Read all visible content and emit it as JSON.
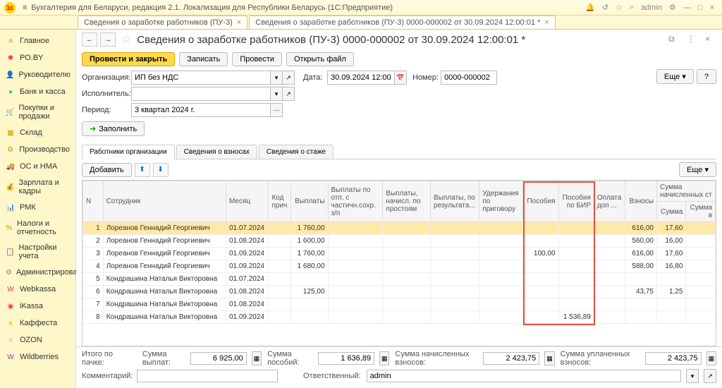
{
  "title": "Бухгалтерия для Беларуси, редакция 2.1. Локализация для Республики Беларусь    (1С:Предприятие)",
  "admin": "admin",
  "tabs": [
    "Сведения о заработке работников (ПУ-3)",
    "Сведения о заработке работников (ПУ-3) 0000-000002 от 30.09.2024 12:00:01 *"
  ],
  "sidebar": [
    {
      "icon": "≡",
      "color": "#c49b00",
      "label": "Главное"
    },
    {
      "icon": "✱",
      "color": "#e34",
      "label": "РО.BY"
    },
    {
      "icon": "👤",
      "color": "#c49b00",
      "label": "Руководителю"
    },
    {
      "icon": "●",
      "color": "#2c8",
      "label": "Банк и касса"
    },
    {
      "icon": "🛒",
      "color": "#c49b00",
      "label": "Покупки и продажи"
    },
    {
      "icon": "▦",
      "color": "#c49b00",
      "label": "Склад"
    },
    {
      "icon": "⚙",
      "color": "#c49b00",
      "label": "Производство"
    },
    {
      "icon": "🚚",
      "color": "#c49b00",
      "label": "ОС и НМА"
    },
    {
      "icon": "💰",
      "color": "#c49b00",
      "label": "Зарплата и кадры"
    },
    {
      "icon": "📊",
      "color": "#c49b00",
      "label": "РМК"
    },
    {
      "icon": "%",
      "color": "#c49b00",
      "label": "Налоги и отчетность"
    },
    {
      "icon": "📋",
      "color": "#c49b00",
      "label": "Настройки учета"
    },
    {
      "icon": "⚙",
      "color": "#888",
      "label": "Администрирование"
    },
    {
      "icon": "W",
      "color": "#e34",
      "label": "Webkassa"
    },
    {
      "icon": "◉",
      "color": "#e34",
      "label": "iKassa"
    },
    {
      "icon": "●",
      "color": "#ffd300",
      "label": "Каффеста"
    },
    {
      "icon": "○",
      "color": "#0af",
      "label": "OZON"
    },
    {
      "icon": "W",
      "color": "#a3a",
      "label": "Wildberries"
    }
  ],
  "doc_title": "Сведения о заработке работников (ПУ-3) 0000-000002 от 30.09.2024 12:00:01 *",
  "buttons": {
    "main": "Провести и закрыть",
    "write": "Записать",
    "post": "Провести",
    "open": "Открыть файл",
    "more": "Еще",
    "help": "?"
  },
  "form": {
    "org_lbl": "Организация:",
    "org": "ИП без НДС",
    "date_lbl": "Дата:",
    "date": "30.09.2024 12:00",
    "num_lbl": "Номер:",
    "num": "0000-000002",
    "exec_lbl": "Исполнитель:",
    "exec": "",
    "period_lbl": "Период:",
    "period": "3 квартал 2024 г.",
    "fill": "Заполнить"
  },
  "subtabs": [
    "Работники организации",
    "Сведения о взносах",
    "Сведения о стаже"
  ],
  "tabletools": {
    "add": "Добавить",
    "more": "Еще"
  },
  "cols": {
    "n": "N",
    "emp": "Сотрудник",
    "month": "Месяц",
    "code": "Код прич",
    "pay": "Выплаты",
    "payott": "Выплаты по отп. с частичн.сохр. з/п",
    "paynach": "Выплаты, начисл. по простоям",
    "payrez": "Выплаты, по результата...",
    "uderzh": "Удержания по приговору",
    "posob": "Пособия",
    "posobbir": "Пособия по БИР",
    "dopl": "Оплата доп ...",
    "vznos": "Взносы",
    "sumnach": "Сумма начисленных ст",
    "summa": "Сумма",
    "summav": "Сумма в"
  },
  "rows": [
    {
      "n": "1",
      "emp": "Лореанов Геннадий Георгиевич",
      "month": "01.07.2024",
      "pay": "1 760,00",
      "posob": "",
      "posobbir": "",
      "vznos": "616,00",
      "summa": "17,60"
    },
    {
      "n": "2",
      "emp": "Лореанов Геннадий Георгиевич",
      "month": "01.08.2024",
      "pay": "1 600,00",
      "posob": "",
      "posobbir": "",
      "vznos": "560,00",
      "summa": "16,00"
    },
    {
      "n": "3",
      "emp": "Лореанов Геннадий Георгиевич",
      "month": "01.09.2024",
      "pay": "1 760,00",
      "posob": "100,00",
      "posobbir": "",
      "vznos": "616,00",
      "summa": "17,60"
    },
    {
      "n": "4",
      "emp": "Лореанов Геннадий Георгиевич",
      "month": "01.09.2024",
      "pay": "1 680,00",
      "posob": "",
      "posobbir": "",
      "vznos": "588,00",
      "summa": "16,80"
    },
    {
      "n": "5",
      "emp": "Кондрашина Наталья Викторовна",
      "month": "01.07.2024",
      "pay": "",
      "posob": "",
      "posobbir": "",
      "vznos": "",
      "summa": ""
    },
    {
      "n": "6",
      "emp": "Кондрашина Наталья Викторовна",
      "month": "01.08.2024",
      "pay": "125,00",
      "posob": "",
      "posobbir": "",
      "vznos": "43,75",
      "summa": "1,25"
    },
    {
      "n": "7",
      "emp": "Кондрашина Наталья Викторовна",
      "month": "01.08.2024",
      "pay": "",
      "posob": "",
      "posobbir": "",
      "vznos": "",
      "summa": ""
    },
    {
      "n": "8",
      "emp": "Кондрашина Наталья Викторовна",
      "month": "01.09.2024",
      "pay": "",
      "posob": "",
      "posobbir": "1 536,89",
      "vznos": "",
      "summa": ""
    }
  ],
  "footer": {
    "itogo": "Итого по пачке:",
    "sumvyp": "Сумма выплат:",
    "sumvyp_v": "6 925,00",
    "sumpos": "Сумма пособий:",
    "sumpos_v": "1 636,89",
    "sumnach": "Сумма начисленных взносов:",
    "sumnach_v": "2 423,75",
    "sumupl": "Сумма уплаченных взносов:",
    "sumupl_v": "2 423,75",
    "komm": "Комментарий:",
    "otv": "Ответственный:",
    "otv_v": "admin"
  }
}
